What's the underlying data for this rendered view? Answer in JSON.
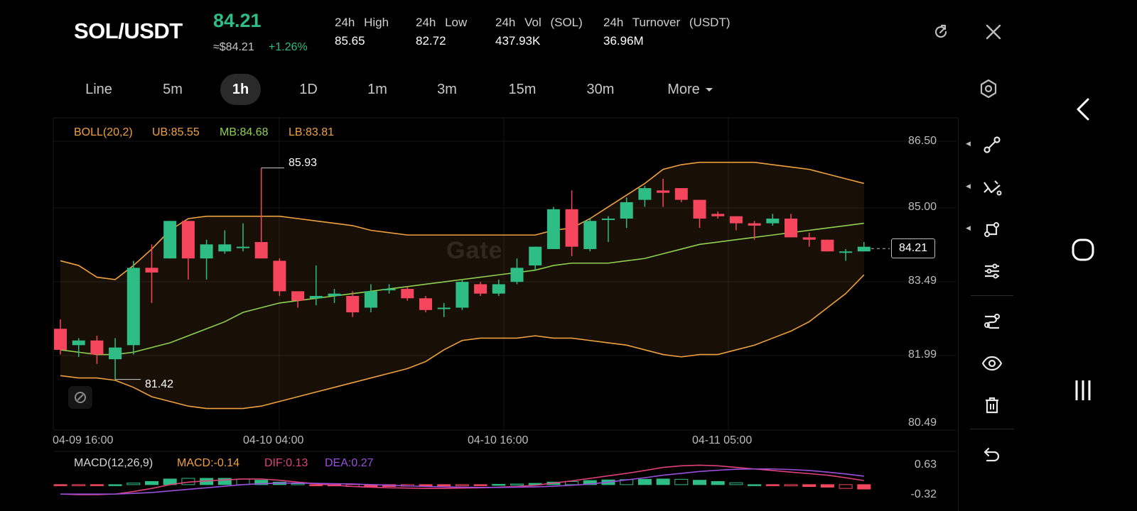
{
  "header": {
    "pair": "SOL/USDT",
    "price": "84.21",
    "approx_price": "≈$84.21",
    "change": "+1.26%",
    "stats": [
      {
        "label": "24h High",
        "value": "85.65"
      },
      {
        "label": "24h Low",
        "value": "82.72"
      },
      {
        "label": "24h Vol (SOL)",
        "value": "437.93K"
      },
      {
        "label": "24h Turnover (USDT)",
        "value": "36.96M"
      }
    ]
  },
  "icons": {
    "refresh": "refresh-icon",
    "close": "close-icon",
    "settings": "gear-icon"
  },
  "timeframes": [
    "Line",
    "5m",
    "1h",
    "1D",
    "1m",
    "3m",
    "15m",
    "30m",
    "More"
  ],
  "active_timeframe": "1h",
  "chart": {
    "legend": {
      "boll": "BOLL(20,2)",
      "ub": "UB:85.55",
      "mb": "MB:84.68",
      "lb": "LB:83.81"
    },
    "y_ticks": [
      "86.50",
      "85.00",
      "83.49",
      "81.99",
      "80.49"
    ],
    "x_ticks": [
      "04-09 16:00",
      "04-10 04:00",
      "04-10 16:00",
      "04-11 05:00"
    ],
    "high_marker": "85.93",
    "low_marker": "81.42",
    "last_price": "84.21",
    "watermark": "Gate",
    "colors": {
      "up": "#2ebd85",
      "down": "#f6465d",
      "boll_band": "#f0a13d",
      "boll_mid": "#8fd14f"
    }
  },
  "macd": {
    "legend": {
      "macd": "MACD(12,26,9)",
      "value": "MACD:-0.14",
      "dif": "DIF:0.13",
      "dea": "DEA:0.27"
    },
    "y_ticks": [
      "0.63",
      "-0.32"
    ],
    "colors": {
      "dif": "#e0407b",
      "dea": "#9b4fdc",
      "value": "#f0a13d"
    }
  },
  "chart_data": {
    "type": "candlestick",
    "x_axis": [
      "04-09 16:00",
      "04-10 04:00",
      "04-10 16:00",
      "04-11 05:00"
    ],
    "y_range": [
      80.49,
      86.5
    ],
    "candles": [
      {
        "o": 82.5,
        "h": 82.7,
        "c": 82.05,
        "l": 81.95
      },
      {
        "o": 82.15,
        "h": 82.3,
        "c": 82.25,
        "l": 81.9
      },
      {
        "o": 82.25,
        "h": 82.35,
        "c": 81.95,
        "l": 81.75
      },
      {
        "o": 81.85,
        "h": 82.3,
        "c": 82.1,
        "l": 81.42
      },
      {
        "o": 82.15,
        "h": 83.95,
        "c": 83.8,
        "l": 81.95
      },
      {
        "o": 83.8,
        "h": 84.3,
        "c": 83.7,
        "l": 83.05
      },
      {
        "o": 84.0,
        "h": 84.8,
        "c": 84.8,
        "l": 84.0
      },
      {
        "o": 84.8,
        "h": 84.8,
        "c": 84.0,
        "l": 83.55
      },
      {
        "o": 84.0,
        "h": 84.4,
        "c": 84.3,
        "l": 83.55
      },
      {
        "o": 84.15,
        "h": 84.6,
        "c": 84.3,
        "l": 84.1
      },
      {
        "o": 84.25,
        "h": 84.75,
        "c": 84.25,
        "l": 84.15
      },
      {
        "o": 84.35,
        "h": 85.93,
        "c": 84.0,
        "l": 84.0
      },
      {
        "o": 83.95,
        "h": 84.0,
        "c": 83.3,
        "l": 83.2
      },
      {
        "o": 83.3,
        "h": 83.3,
        "c": 83.1,
        "l": 82.95
      },
      {
        "o": 83.15,
        "h": 83.85,
        "c": 83.2,
        "l": 83.0
      },
      {
        "o": 83.2,
        "h": 83.35,
        "c": 83.25,
        "l": 83.05
      },
      {
        "o": 83.2,
        "h": 83.3,
        "c": 82.85,
        "l": 82.75
      },
      {
        "o": 82.95,
        "h": 83.45,
        "c": 83.3,
        "l": 82.85
      },
      {
        "o": 83.35,
        "h": 83.45,
        "c": 83.35,
        "l": 83.25
      },
      {
        "o": 83.35,
        "h": 83.4,
        "c": 83.15,
        "l": 83.1
      },
      {
        "o": 83.15,
        "h": 83.2,
        "c": 82.9,
        "l": 82.85
      },
      {
        "o": 82.95,
        "h": 83.05,
        "c": 82.95,
        "l": 82.75
      },
      {
        "o": 82.95,
        "h": 83.55,
        "c": 83.5,
        "l": 82.9
      },
      {
        "o": 83.45,
        "h": 83.5,
        "c": 83.25,
        "l": 83.2
      },
      {
        "o": 83.25,
        "h": 83.55,
        "c": 83.45,
        "l": 83.2
      },
      {
        "o": 83.5,
        "h": 84.0,
        "c": 83.8,
        "l": 83.45
      },
      {
        "o": 83.85,
        "h": 84.25,
        "c": 84.25,
        "l": 83.75
      },
      {
        "o": 84.2,
        "h": 85.1,
        "c": 85.05,
        "l": 84.2
      },
      {
        "o": 85.05,
        "h": 85.45,
        "c": 84.25,
        "l": 84.05
      },
      {
        "o": 84.2,
        "h": 84.85,
        "c": 84.8,
        "l": 84.15
      },
      {
        "o": 84.85,
        "h": 84.9,
        "c": 84.85,
        "l": 84.35
      },
      {
        "o": 84.85,
        "h": 85.3,
        "c": 85.2,
        "l": 84.65
      },
      {
        "o": 85.25,
        "h": 85.55,
        "c": 85.5,
        "l": 85.1
      },
      {
        "o": 85.45,
        "h": 85.7,
        "c": 85.4,
        "l": 85.1
      },
      {
        "o": 85.5,
        "h": 85.5,
        "c": 85.25,
        "l": 85.2
      },
      {
        "o": 85.25,
        "h": 85.25,
        "c": 84.85,
        "l": 84.65
      },
      {
        "o": 84.95,
        "h": 85.0,
        "c": 84.9,
        "l": 84.85
      },
      {
        "o": 84.9,
        "h": 84.9,
        "c": 84.75,
        "l": 84.6
      },
      {
        "o": 84.75,
        "h": 84.8,
        "c": 84.7,
        "l": 84.4
      },
      {
        "o": 84.75,
        "h": 84.95,
        "c": 84.85,
        "l": 84.7
      },
      {
        "o": 84.85,
        "h": 84.95,
        "c": 84.45,
        "l": 84.45
      },
      {
        "o": 84.45,
        "h": 84.55,
        "c": 84.4,
        "l": 84.25
      },
      {
        "o": 84.4,
        "h": 84.4,
        "c": 84.15,
        "l": 84.15
      },
      {
        "o": 84.15,
        "h": 84.2,
        "c": 84.15,
        "l": 83.95
      },
      {
        "o": 84.15,
        "h": 84.35,
        "c": 84.25,
        "l": 84.15
      }
    ],
    "boll_upper": [
      83.95,
      83.85,
      83.6,
      83.55,
      83.85,
      84.2,
      84.6,
      84.85,
      84.9,
      84.9,
      84.9,
      84.9,
      84.9,
      84.85,
      84.8,
      84.75,
      84.7,
      84.6,
      84.55,
      84.5,
      84.5,
      84.5,
      84.5,
      84.5,
      84.5,
      84.5,
      84.5,
      84.6,
      84.65,
      84.85,
      85.1,
      85.35,
      85.6,
      85.9,
      86.0,
      86.05,
      86.05,
      86.05,
      86.05,
      86.0,
      85.95,
      85.9,
      85.8,
      85.7,
      85.6
    ],
    "boll_mid": [
      82.05,
      82.0,
      81.95,
      81.95,
      82.0,
      82.1,
      82.2,
      82.35,
      82.5,
      82.65,
      82.85,
      82.95,
      83.05,
      83.1,
      83.15,
      83.2,
      83.25,
      83.3,
      83.35,
      83.4,
      83.45,
      83.5,
      83.55,
      83.6,
      83.65,
      83.7,
      83.75,
      83.85,
      83.9,
      83.9,
      83.9,
      83.95,
      84.0,
      84.1,
      84.2,
      84.3,
      84.35,
      84.4,
      84.45,
      84.5,
      84.55,
      84.6,
      84.65,
      84.7,
      84.75
    ],
    "boll_lower": [
      81.5,
      81.45,
      81.45,
      81.4,
      81.25,
      81.05,
      80.95,
      80.85,
      80.8,
      80.8,
      80.8,
      80.85,
      80.95,
      81.05,
      81.15,
      81.25,
      81.35,
      81.45,
      81.55,
      81.65,
      81.8,
      82.05,
      82.25,
      82.3,
      82.3,
      82.3,
      82.35,
      82.3,
      82.3,
      82.25,
      82.2,
      82.15,
      82.05,
      81.95,
      81.9,
      81.95,
      81.95,
      82.05,
      82.15,
      82.3,
      82.45,
      82.65,
      82.95,
      83.25,
      83.65
    ],
    "macd_dif": [
      -0.3,
      -0.32,
      -0.32,
      -0.3,
      -0.22,
      -0.12,
      0.0,
      0.08,
      0.12,
      0.15,
      0.18,
      0.18,
      0.14,
      0.08,
      0.03,
      -0.02,
      -0.06,
      -0.08,
      -0.1,
      -0.11,
      -0.12,
      -0.12,
      -0.11,
      -0.1,
      -0.08,
      -0.06,
      -0.02,
      0.05,
      0.12,
      0.2,
      0.28,
      0.36,
      0.45,
      0.55,
      0.6,
      0.62,
      0.6,
      0.55,
      0.5,
      0.45,
      0.4,
      0.35,
      0.3,
      0.22,
      0.13
    ],
    "macd_dea": [
      -0.3,
      -0.3,
      -0.3,
      -0.3,
      -0.28,
      -0.25,
      -0.2,
      -0.15,
      -0.1,
      -0.05,
      0.0,
      0.03,
      0.05,
      0.05,
      0.04,
      0.03,
      0.02,
      0.0,
      -0.02,
      -0.04,
      -0.06,
      -0.07,
      -0.08,
      -0.09,
      -0.09,
      -0.08,
      -0.07,
      -0.05,
      -0.02,
      0.02,
      0.08,
      0.15,
      0.22,
      0.3,
      0.36,
      0.42,
      0.46,
      0.49,
      0.5,
      0.5,
      0.48,
      0.45,
      0.4,
      0.34,
      0.27
    ],
    "macd_hist": [
      -0.02,
      -0.03,
      -0.02,
      0.0,
      0.05,
      0.1,
      0.18,
      0.2,
      0.2,
      0.2,
      0.18,
      0.14,
      0.08,
      0.03,
      -0.01,
      -0.04,
      -0.06,
      -0.06,
      -0.06,
      -0.05,
      -0.05,
      -0.04,
      -0.03,
      -0.01,
      0.01,
      0.02,
      0.04,
      0.08,
      0.1,
      0.13,
      0.15,
      0.16,
      0.17,
      0.18,
      0.17,
      0.14,
      0.1,
      0.06,
      0.0,
      -0.02,
      -0.04,
      -0.06,
      -0.08,
      -0.12,
      -0.14
    ]
  },
  "toolbar": [
    "trend-line-icon",
    "cross-line-icon",
    "shape-icon",
    "adjust-icon",
    "indicator-icon",
    "visibility-icon",
    "trash-icon",
    "undo-icon"
  ],
  "system_nav": [
    "back-icon",
    "home-icon",
    "recents-icon"
  ]
}
